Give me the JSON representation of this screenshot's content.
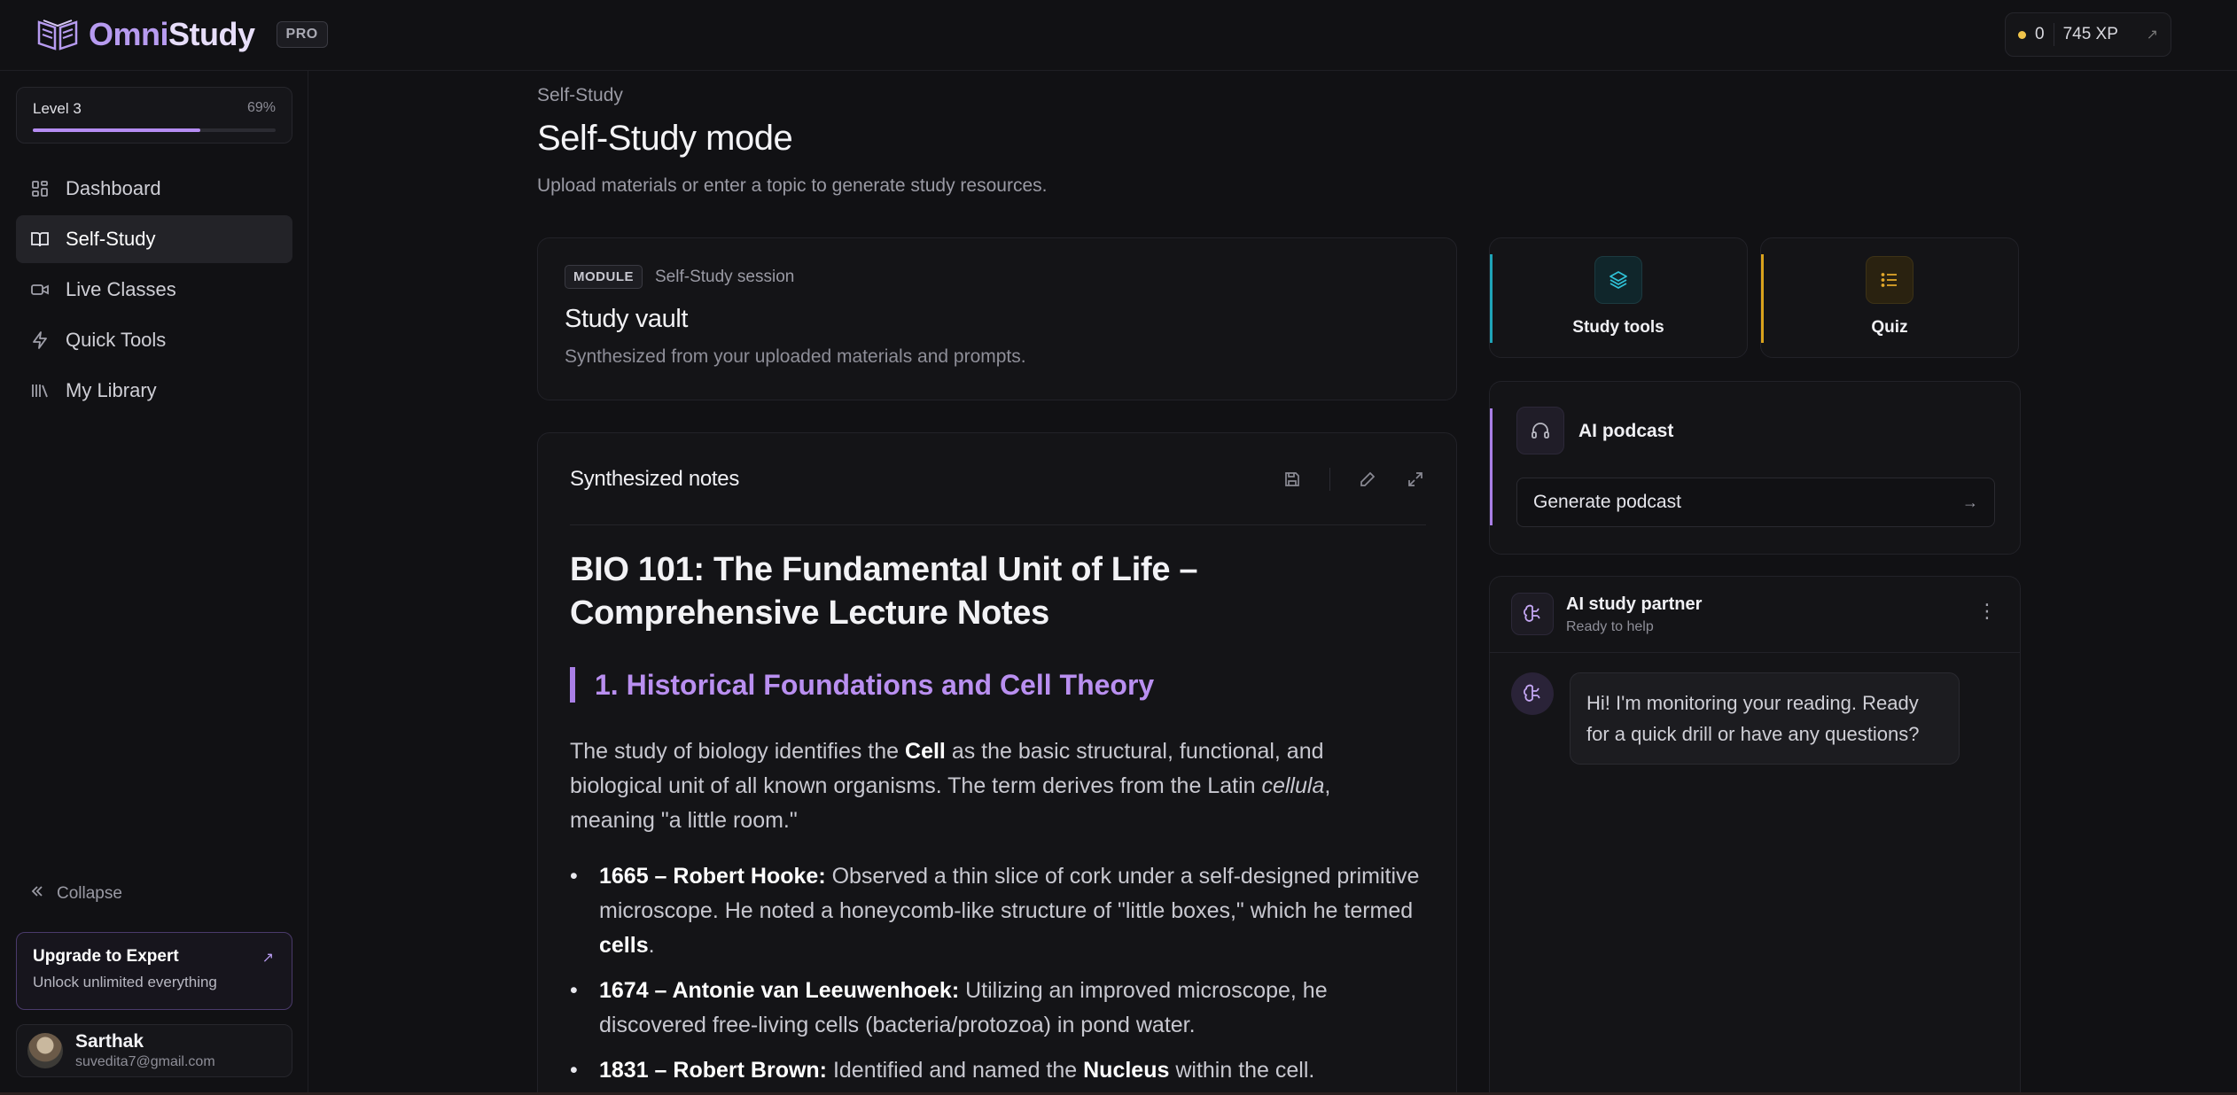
{
  "app": {
    "name_part1": "Omni",
    "name_part2": "Study",
    "badge": "PRO"
  },
  "topbar": {
    "coins": "0",
    "xp": "745 XP",
    "xp_arrow": "↗"
  },
  "sidebar": {
    "level_label": "Level 3",
    "level_percent_label": "69%",
    "level_progress": 0.69,
    "items": [
      {
        "label": "Dashboard",
        "icon": "grid-icon",
        "active": false
      },
      {
        "label": "Self-Study",
        "icon": "book-icon",
        "active": true
      },
      {
        "label": "Live Classes",
        "icon": "video-icon",
        "active": false
      },
      {
        "label": "Quick Tools",
        "icon": "bolt-icon",
        "active": false
      },
      {
        "label": "My Library",
        "icon": "library-icon",
        "active": false
      }
    ],
    "collapse_label": "Collapse",
    "upgrade": {
      "title": "Upgrade to Expert",
      "subtitle": "Unlock unlimited everything"
    },
    "user": {
      "name": "Sarthak",
      "email": "suvedita7@gmail.com"
    }
  },
  "main": {
    "breadcrumb": "Self-Study",
    "title": "Self-Study mode",
    "subtitle": "Upload materials or enter a topic to generate study resources."
  },
  "vault": {
    "tag": "MODULE",
    "session": "Self-Study session",
    "title": "Study vault",
    "description": "Synthesized from your uploaded materials and prompts."
  },
  "notes": {
    "header": "Synthesized notes",
    "h1": "BIO 101: The Fundamental Unit of Life – Comprehensive Lecture Notes",
    "h2": "1. Historical Foundations and Cell Theory",
    "p1_a": "The study of biology identifies the ",
    "p1_b": "Cell",
    "p1_c": " as the basic structural, functional, and biological unit of all known organisms. The term derives from the Latin ",
    "p1_d": "cellula",
    "p1_e": ", meaning \"a little room.\"",
    "bullets": [
      {
        "bold": "1665 – Robert Hooke:",
        "text": " Observed a thin slice of cork under a self-designed primitive microscope. He noted a honeycomb-like structure of \"little boxes,\" which he termed ",
        "bold2": "cells",
        "tail": "."
      },
      {
        "bold": "1674 – Antonie van Leeuwenhoek:",
        "text": " Utilizing an improved microscope, he discovered free-living cells (bacteria/protozoa) in pond water.",
        "bold2": "",
        "tail": ""
      },
      {
        "bold": "1831 – Robert Brown:",
        "text": " Identified and named the ",
        "bold2": "Nucleus",
        "tail": " within the cell."
      }
    ]
  },
  "features": {
    "study_tools": "Study tools",
    "quiz": "Quiz",
    "study_tools_color": "#1fa4b8",
    "quiz_color": "#d9a21c"
  },
  "podcast": {
    "title": "AI podcast",
    "button": "Generate podcast"
  },
  "partner": {
    "name": "AI study partner",
    "status": "Ready to help",
    "message": "Hi! I'm monitoring your reading. Ready for a quick drill or have any questions?"
  },
  "colors": {
    "accent": "#b58cf2",
    "background": "#111114"
  }
}
